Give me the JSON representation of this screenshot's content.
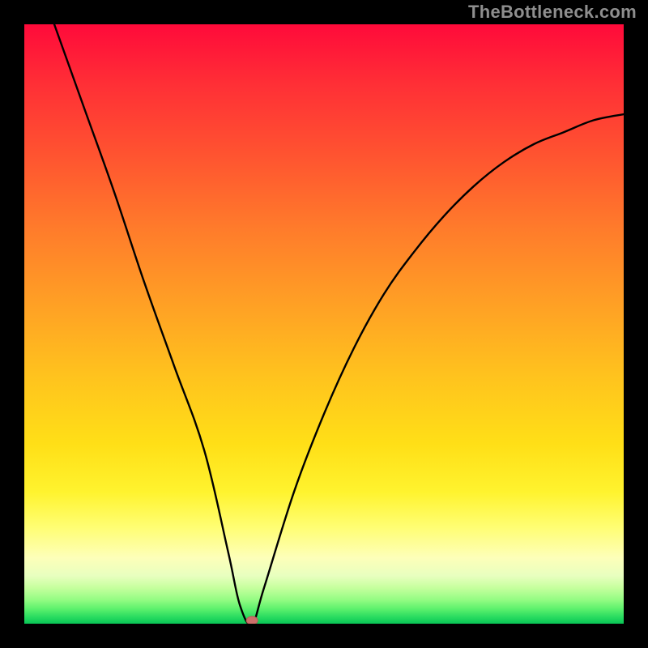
{
  "watermark": "TheBottleneck.com",
  "chart_data": {
    "type": "line",
    "title": "",
    "xlabel": "",
    "ylabel": "",
    "xlim": [
      0,
      100
    ],
    "ylim": [
      0,
      100
    ],
    "grid": false,
    "legend": false,
    "series": [
      {
        "name": "bottleneck-curve",
        "x": [
          5,
          10,
          15,
          20,
          25,
          30,
          34,
          36,
          38,
          40,
          45,
          50,
          55,
          60,
          65,
          70,
          75,
          80,
          85,
          90,
          95,
          100
        ],
        "values": [
          100,
          86,
          72,
          57,
          43,
          29,
          12,
          3,
          0,
          6,
          22,
          35,
          46,
          55,
          62,
          68,
          73,
          77,
          80,
          82,
          84,
          85
        ]
      }
    ],
    "annotations": [
      {
        "type": "min-marker",
        "x": 38,
        "y": 0
      }
    ],
    "background": {
      "type": "vertical-gradient",
      "stops": [
        {
          "pos": 0,
          "color": "#ff0a3a"
        },
        {
          "pos": 50,
          "color": "#ffb020"
        },
        {
          "pos": 80,
          "color": "#fff32e"
        },
        {
          "pos": 100,
          "color": "#09c456"
        }
      ]
    }
  }
}
